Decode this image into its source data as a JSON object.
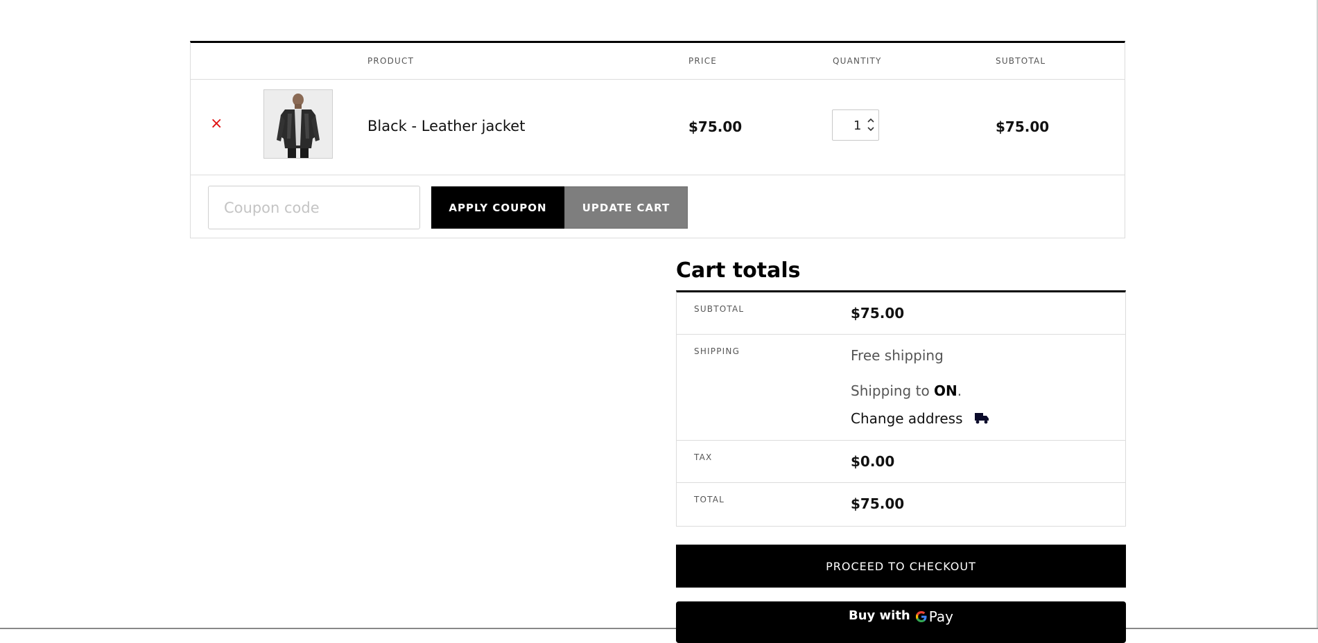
{
  "cart_table": {
    "headers": {
      "product": "PRODUCT",
      "price": "PRICE",
      "quantity": "QUANTITY",
      "subtotal": "SUBTOTAL"
    },
    "items": [
      {
        "remove_glyph": "×",
        "name": "Black - Leather jacket",
        "price": "$75.00",
        "quantity": "1",
        "subtotal": "$75.00",
        "thumbnail_icon": "leather-jacket-photo"
      }
    ]
  },
  "coupon": {
    "placeholder": "Coupon code",
    "value": "",
    "apply_label": "APPLY COUPON",
    "update_label": "UPDATE CART"
  },
  "totals": {
    "title": "Cart totals",
    "subtotal_label": "SUBTOTAL",
    "subtotal_value": "$75.00",
    "shipping_label": "SHIPPING",
    "shipping_method": "Free shipping",
    "shipping_to_prefix": "Shipping to ",
    "shipping_to_region": "ON",
    "shipping_to_suffix": ".",
    "change_address": "Change address",
    "change_address_icon": "truck-icon",
    "tax_label": "TAX",
    "tax_value": "$0.00",
    "total_label": "TOTAL",
    "total_value": "$75.00"
  },
  "checkout": {
    "proceed_label": "PROCEED TO CHECKOUT",
    "gpay_prefix": "Buy with",
    "gpay_word": "Pay"
  },
  "colors": {
    "remove": "#e01010",
    "primary_button": "#000000",
    "update_button": "#7e7e7e"
  }
}
